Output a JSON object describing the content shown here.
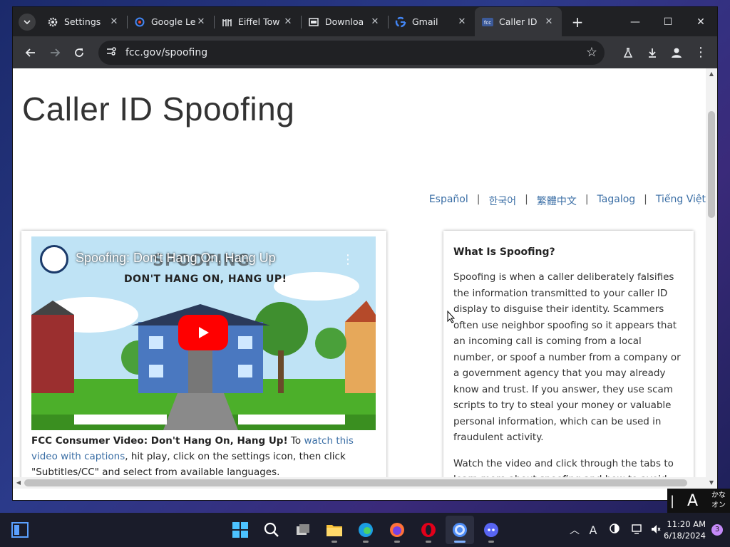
{
  "tabs": [
    {
      "title": "Settings",
      "icon": "gear-icon"
    },
    {
      "title": "Google Le",
      "icon": "google-lens-icon"
    },
    {
      "title": "Eiffel Tow",
      "icon": "eiffel-site-icon"
    },
    {
      "title": "Downloa",
      "icon": "download-site-icon"
    },
    {
      "title": "Gmail",
      "icon": "google-icon"
    },
    {
      "title": "Caller ID",
      "icon": "fcc-icon",
      "active": true
    }
  ],
  "address_bar": {
    "url": "fcc.gov/spoofing"
  },
  "page": {
    "title": "Caller ID Spoofing",
    "languages": [
      "Español",
      "한국어",
      "繁體中文",
      "Tagalog",
      "Tiếng Việt"
    ],
    "video": {
      "title": "Spoofing: Don't Hang On, Hang Up",
      "overlay_big": "SPOOFING",
      "overlay_sub": "DON'T HANG ON, HANG UP!"
    },
    "caption": {
      "bold": "FCC Consumer Video: Don't Hang On, Hang Up!",
      "pre_link": " To ",
      "link": "watch this video with captions",
      "post_link": ", hit play, click on the settings icon, then click \"Subtitles/CC\" and select from available languages."
    },
    "sidebar": {
      "heading": "What Is Spoofing?",
      "paragraph1": "Spoofing is when a caller deliberately falsifies the information transmitted to your caller ID display to disguise their identity. Scammers often use neighbor spoofing so it appears that an incoming call is coming from a local number, or spoof a number from a company or a government agency that you may already know and trust. If you answer, they use scam scripts to try to steal your money or valuable personal information, which can be used in fraudulent activity.",
      "paragraph2": "Watch the video and click through the tabs to learn more about spoofing and how to avoid being scammed."
    }
  },
  "ime": {
    "mode": "A",
    "kana_top": "かな",
    "kana_bottom": "オン"
  },
  "taskbar": {
    "time": "11:20 AM",
    "date": "6/18/2024",
    "tray_font": "A",
    "notification_count": "3"
  },
  "colors": {
    "link": "#3a6ea5",
    "chrome_dark": "#202124",
    "chrome_mid": "#35363a",
    "yt_red": "#ff0000"
  }
}
